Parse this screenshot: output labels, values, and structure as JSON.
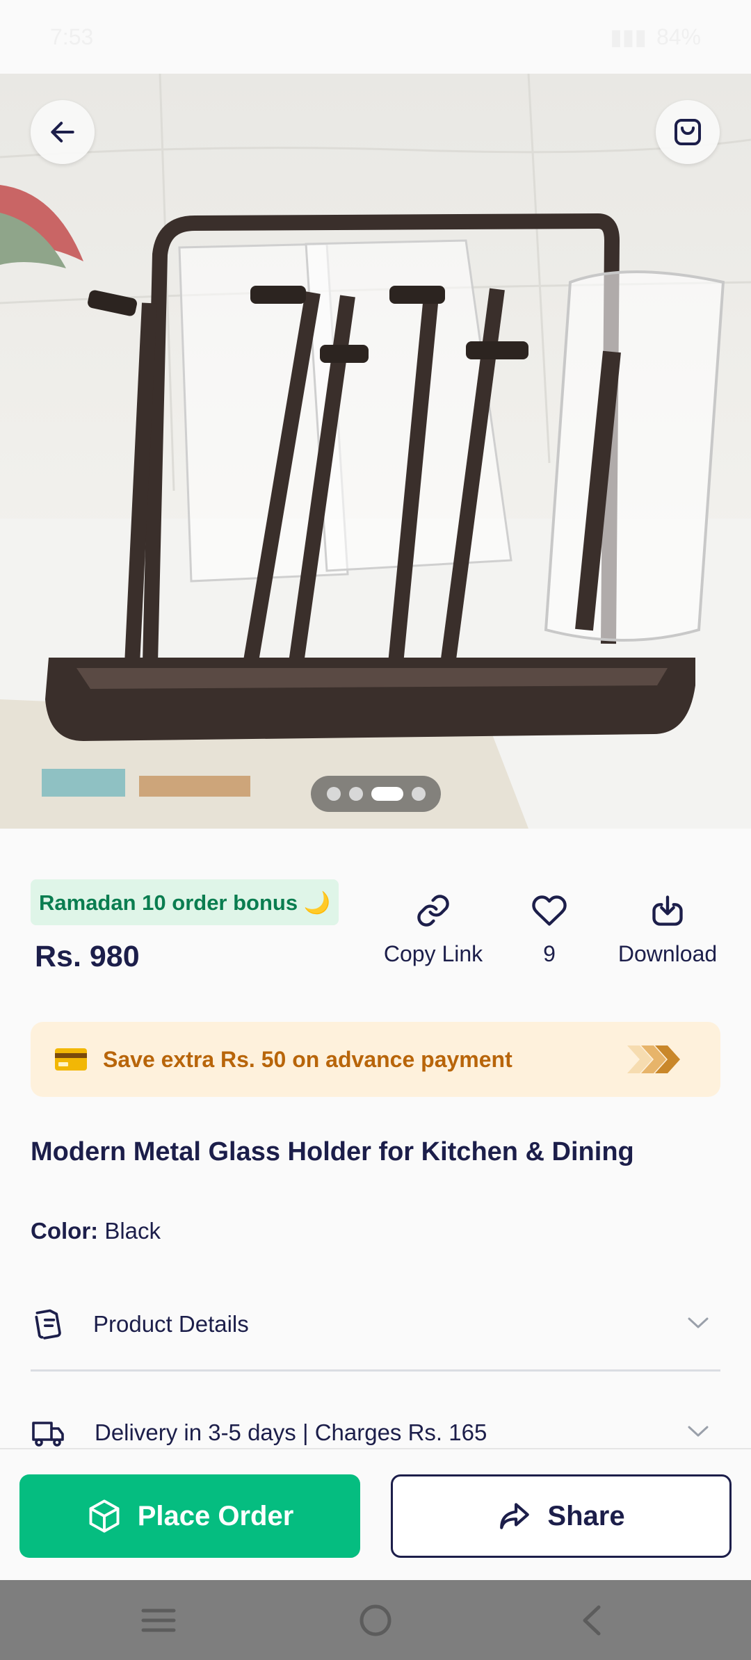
{
  "status_bar": {
    "time": "7:53",
    "battery": "84%"
  },
  "hero": {
    "image_count": 4,
    "active_index": 2
  },
  "badge": {
    "text": "Ramadan 10 order bonus 🌙"
  },
  "price": "Rs. 980",
  "actions": {
    "copy_link": "Copy Link",
    "like_count": "9",
    "download": "Download"
  },
  "promo": {
    "text": "Save extra Rs. 50 on advance payment"
  },
  "product": {
    "title": "Modern Metal Glass Holder for Kitchen & Dining",
    "color_label": "Color:",
    "color_value": "Black"
  },
  "accordion": {
    "details": "Product Details",
    "delivery": "Delivery in 3-5 days | Charges Rs. 165"
  },
  "buttons": {
    "place_order": "Place Order",
    "share": "Share"
  },
  "colors": {
    "accent_green": "#05bd80",
    "navy": "#1c1e4a",
    "promo_bg": "#fef1dc",
    "promo_text": "#b8650a"
  }
}
